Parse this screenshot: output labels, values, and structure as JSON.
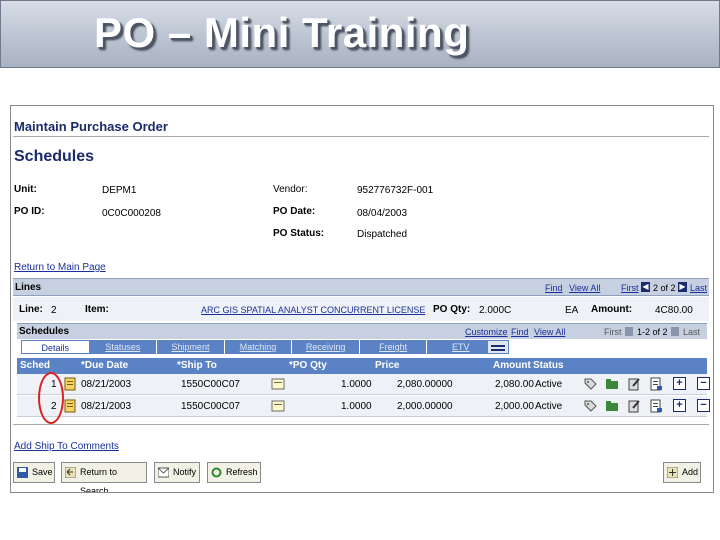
{
  "slide": {
    "title": "PO – Mini Training"
  },
  "page": {
    "header": "Maintain Purchase Order",
    "section_title": "Schedules",
    "fields": {
      "unit_label": "Unit:",
      "unit_value": "DEPM1",
      "vendor_label": "Vendor:",
      "vendor_value": "952776732F-001",
      "poid_label": "PO ID:",
      "poid_value": "0C0C000208",
      "podate_label": "PO Date:",
      "podate_value": "08/04/2003",
      "postatus_label": "PO Status:",
      "postatus_value": "Dispatched"
    },
    "return_link": "Return to Main Page"
  },
  "lines": {
    "title": "Lines",
    "find": "Find",
    "view_all": "View All",
    "first": "First",
    "page_info": "2 of 2",
    "last": "Last",
    "line_label": "Line:",
    "line_value": "2",
    "item_label": "Item:",
    "item_value": "ARC GIS SPATIAL ANALYST CONCURRENT LICENSE",
    "poqty_label": "PO Qty:",
    "poqty_value": "2.000C",
    "uom": "EA",
    "amount_label": "Amount:",
    "amount_value": "4C80.00"
  },
  "schedules": {
    "title": "Schedules",
    "customize": "Customize",
    "find": "Find",
    "view_all": "View All",
    "first": "First",
    "page_info": "1-2 of 2",
    "last": "Last",
    "tabs": [
      "Details",
      "Statuses",
      "Shipment",
      "Matching",
      "Receiving",
      "Freight",
      "ETV"
    ],
    "columns": [
      "Sched",
      "*Due Date",
      "*Ship To",
      "*PO Qty",
      "Price",
      "Amount",
      "Status"
    ],
    "rows": [
      {
        "sched": "1",
        "due": "08/21/2003",
        "ship_to": "1550C00C07",
        "qty": "1.0000",
        "price": "2,080.00000",
        "amount": "2,080.00",
        "status": "Active"
      },
      {
        "sched": "2",
        "due": "08/21/2003",
        "ship_to": "1550C00C07",
        "qty": "1.0000",
        "price": "2,000.00000",
        "amount": "2,000.00",
        "status": "Active"
      }
    ]
  },
  "add_comments_link": "Add Ship To Comments",
  "buttons": {
    "save": "Save",
    "return_to_search": "Return to Search",
    "notify": "Notify",
    "refresh": "Refresh",
    "add": "Add"
  },
  "colors": {
    "accent": "#5a82c4",
    "header_blue": "#1b2a6b",
    "link": "#1a2f9a",
    "highlight_circle": "#e02020"
  }
}
